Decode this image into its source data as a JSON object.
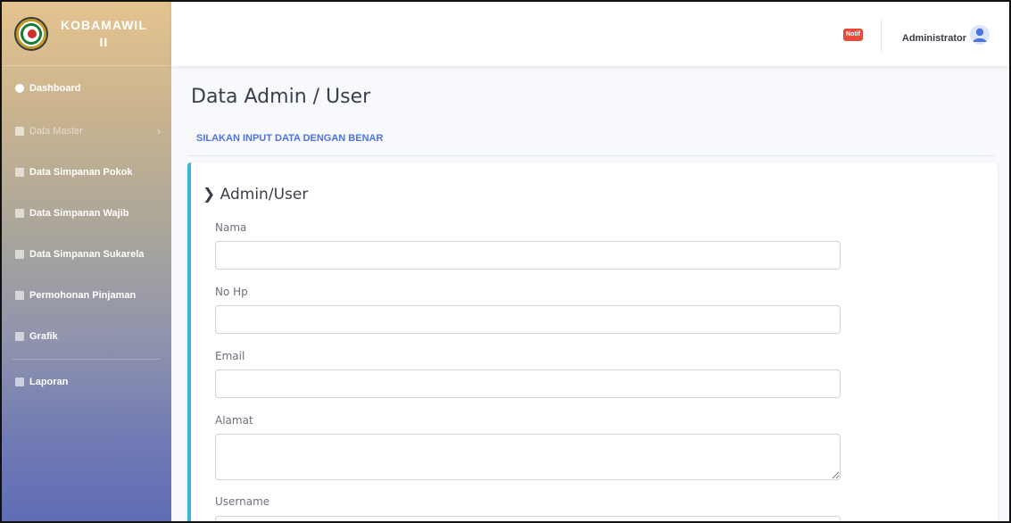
{
  "brand": {
    "line1": "KOBAMAWIL",
    "line2": "II"
  },
  "sidebar": {
    "items": [
      {
        "label": "Dashboard",
        "icon": "dashboard-icon"
      },
      {
        "label": "Data Master",
        "icon": "list-icon"
      },
      {
        "label": "Data Simpanan Pokok",
        "icon": "book-icon"
      },
      {
        "label": "Data Simpanan Wajib",
        "icon": "book-icon"
      },
      {
        "label": "Data Simpanan Sukarela",
        "icon": "book-icon"
      },
      {
        "label": "Permohonan Pinjaman",
        "icon": "file-icon"
      },
      {
        "label": "Grafik",
        "icon": "list-icon"
      },
      {
        "label": "Laporan",
        "icon": "print-icon"
      }
    ]
  },
  "topbar": {
    "notif_label": "Notif",
    "user_name": "Administrator"
  },
  "main": {
    "title": "Data Admin / User",
    "subtitle": "SILAKAN INPUT DATA DENGAN BENAR",
    "card_title": "Admin/User",
    "fields": [
      {
        "label": "Nama",
        "value": ""
      },
      {
        "label": "No Hp",
        "value": ""
      },
      {
        "label": "Email",
        "value": ""
      },
      {
        "label": "Alamat",
        "value": ""
      },
      {
        "label": "Username",
        "value": ""
      }
    ]
  },
  "colors": {
    "accent": "#4e73df",
    "card_border": "#36b9cc",
    "notif": "#e74a3b"
  }
}
